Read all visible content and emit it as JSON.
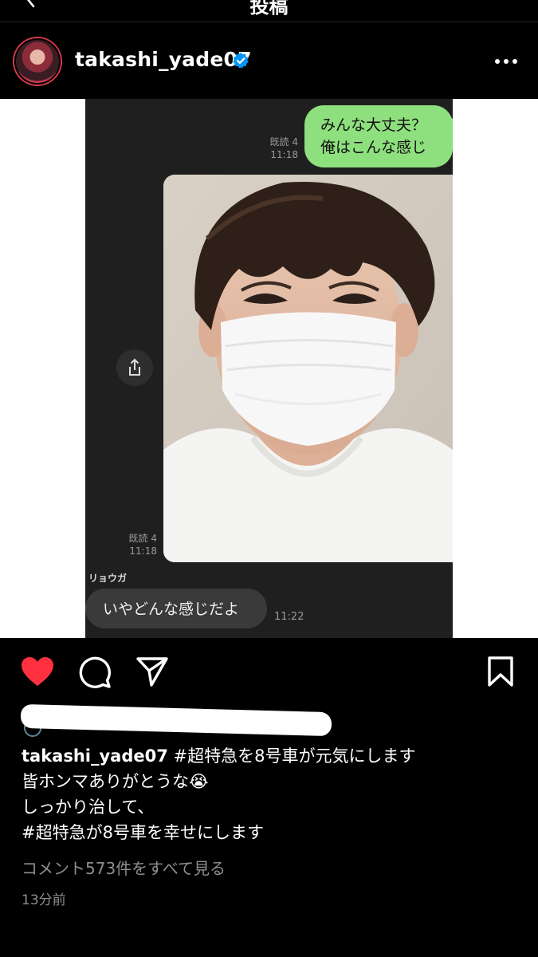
{
  "nav": {
    "title": "投稿"
  },
  "post": {
    "username": "takashi_yade07",
    "verified": true
  },
  "chat": {
    "outgoing_message_line1": "みんな大丈夫？",
    "outgoing_message_line2": "俺はこんな感じ",
    "read_label_1": "既読 4",
    "read_time_1": "11:18",
    "read_label_2": "既読 4",
    "read_time_2": "11:18",
    "reply_sender": "リョウガ",
    "reply_message": "いやどんな感じだよ",
    "reply_time": "11:22"
  },
  "caption": {
    "username": "takashi_yade07",
    "line1_text": "#超特急を8号車が元気にします",
    "line2": "皆ホンマありがとうな😭",
    "line3": "しっかり治して、",
    "line4": "#超特急が8号車を幸せにします"
  },
  "view_comments": "コメント573件をすべて見る",
  "timestamp": "13分前",
  "colors": {
    "background": "#000000",
    "like_red": "#ff3040",
    "verified_blue": "#0095f6",
    "line_green": "#8ee07e",
    "muted_text": "#8e8e8e"
  }
}
